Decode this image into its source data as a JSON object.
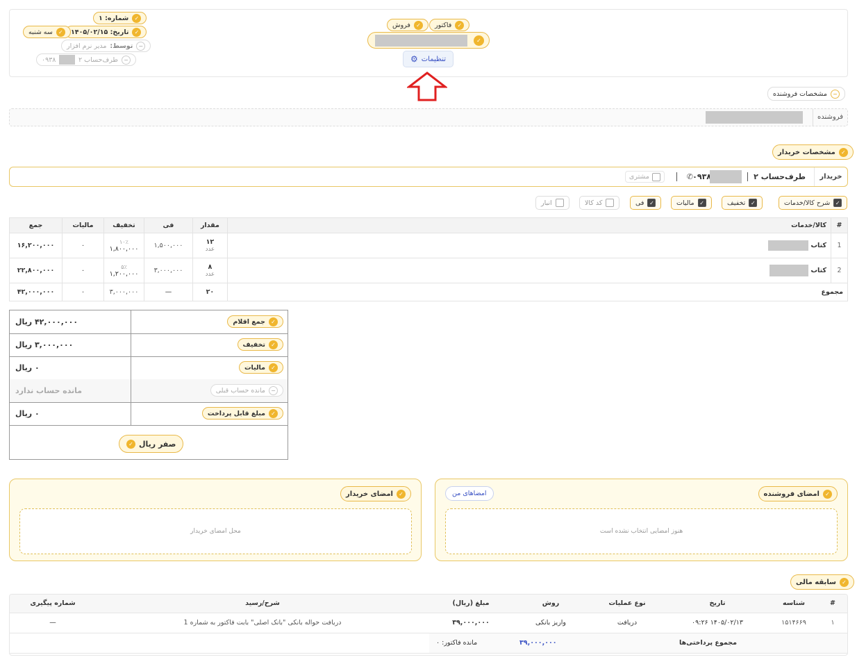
{
  "header": {
    "number_label": "شماره: ۱",
    "date_label": "تاریخ: ۱۴۰۵/۰۲/۱۵",
    "weekday": "سه شنبه",
    "by_prefix": "توسط:",
    "by_value": "مدیر نرم افزار",
    "party_label": "طرف‌حساب ۲",
    "party_phone": "۰۹۳۸",
    "type_invoice": "فاکتور",
    "type_sale": "فروش",
    "settings_label": "تنظیمات"
  },
  "seller": {
    "section_label": "مشخصات فروشنده",
    "field_label": "فروشنده"
  },
  "buyer": {
    "section_label": "مشخصات خریدار",
    "field_label": "خریدار",
    "name": "طرف‌حساب ۲",
    "phone": "۰۹۳۸",
    "customer_label": "مشتری"
  },
  "options": [
    {
      "label": "شرح کالا/خدمات",
      "checked": true
    },
    {
      "label": "تخفیف",
      "checked": true
    },
    {
      "label": "مالیات",
      "checked": true
    },
    {
      "label": "فی",
      "checked": true
    },
    {
      "label": "کد کالا",
      "checked": false
    },
    {
      "label": "انبار",
      "checked": false
    }
  ],
  "items_table": {
    "headers": {
      "num": "#",
      "product": "کالا/خدمات",
      "qty": "مقدار",
      "price": "فی",
      "discount": "تخفیف",
      "tax": "مالیات",
      "total": "جمع"
    },
    "rows": [
      {
        "num": "1",
        "product": "کتاب",
        "qty": "۱۲",
        "unit": "عدد",
        "price": "۱,۵۰۰,۰۰۰",
        "discount_pct": "۱۰٪",
        "discount": "۱,۸۰۰,۰۰۰",
        "tax": "۰",
        "total": "۱۶,۲۰۰,۰۰۰"
      },
      {
        "num": "2",
        "product": "کتاب",
        "qty": "۸",
        "unit": "عدد",
        "price": "۳,۰۰۰,۰۰۰",
        "discount_pct": "۵٪",
        "discount": "۱,۲۰۰,۰۰۰",
        "tax": "۰",
        "total": "۲۲,۸۰۰,۰۰۰"
      }
    ],
    "footer": {
      "label": "مجموع",
      "qty": "۲۰",
      "price": "—",
      "discount": "۳,۰۰۰,۰۰۰",
      "tax": "۰",
      "total": "۴۲,۰۰۰,۰۰۰"
    }
  },
  "summary": {
    "items_total_label": "جمع اقلام",
    "items_total": "۴۲,۰۰۰,۰۰۰ ریال",
    "discount_label": "تخفیف",
    "discount": "۳,۰۰۰,۰۰۰ ریال",
    "tax_label": "مالیات",
    "tax": "۰ ریال",
    "prev_balance_label": "مانده حساب قبلی",
    "prev_balance": "مانده حساب ندارد",
    "payable_label": "مبلغ قابل پرداخت",
    "payable": "۰ ریال",
    "zero_button": "صفر ریال"
  },
  "signatures": {
    "seller_label": "امضای فروشنده",
    "my_signatures": "امضاهای من",
    "seller_empty": "هنوز امضایی انتخاب نشده است",
    "buyer_label": "امضای خریدار",
    "buyer_placeholder": "محل امضای خریدار"
  },
  "finance": {
    "section_label": "سابقه مالی",
    "headers": {
      "num": "#",
      "id": "شناسه",
      "date": "تاریخ",
      "op": "نوع عملیات",
      "method": "روش",
      "amount": "مبلغ (ریال)",
      "desc": "شرح/رسید",
      "tracking": "شماره پیگیری"
    },
    "rows": [
      {
        "num": "۱",
        "id": "۱۵۱۴۶۶۹",
        "date": "۱۴۰۵/۰۲/۱۳ ۰۹:۲۶",
        "op": "دریافت",
        "method": "واریز بانکی",
        "amount": "۳۹,۰۰۰,۰۰۰",
        "desc": "دریافت حواله بانکی \"بانک اصلی\" بابت فاکتور به شماره 1",
        "tracking": "—"
      }
    ],
    "footer": {
      "total_label": "مجموع پرداختی‌ها",
      "total": "۳۹,۰۰۰,۰۰۰",
      "remaining_label": "مانده فاکتور: ۰"
    }
  },
  "colors": {
    "accent": "#f0b62e",
    "annotation_arrow": "#e02020",
    "link_blue": "#3a52c4"
  }
}
